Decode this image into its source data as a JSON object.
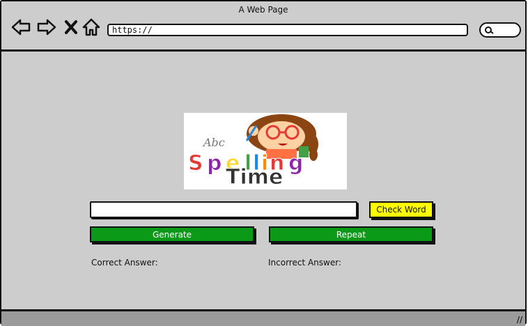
{
  "window": {
    "title": "A Web Page"
  },
  "browser": {
    "url": "https://",
    "icons": [
      "back-arrow-icon",
      "forward-arrow-icon",
      "close-x-icon",
      "home-icon",
      "search-icon"
    ]
  },
  "logo": {
    "abc_text": "Abc",
    "line1": "Spelling",
    "line2": "Time",
    "letter_colors": [
      "#e53935",
      "#8e24aa",
      "#fdd835",
      "#43a047",
      "#1e88e5",
      "#fb8c00",
      "#e53935",
      "#8e24aa"
    ]
  },
  "controls": {
    "word_input_value": "",
    "check_label": "Check Word",
    "generate_label": "Generate",
    "repeat_label": "Repeat"
  },
  "results": {
    "correct_label": "Correct Answer:",
    "incorrect_label": "Incorrect Answer:"
  },
  "colors": {
    "accent_green": "#0a9a18",
    "accent_yellow": "#ffff00",
    "background": "#cdcdcd"
  }
}
